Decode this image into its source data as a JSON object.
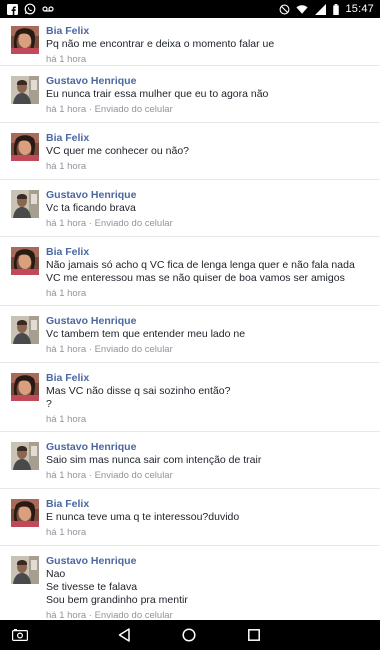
{
  "status_bar": {
    "left_icons": [
      "facebook-icon",
      "whatsapp-icon",
      "voicemail-icon"
    ],
    "right_icons": [
      "do-not-disturb-icon",
      "wifi-icon",
      "signal-icon",
      "battery-icon"
    ],
    "time": "15:47"
  },
  "messages": [
    {
      "author": "Bia Felix",
      "lines": [
        "Pq não me encontrar e deixa o momento falar ue"
      ],
      "meta": "há 1 hora",
      "avatar": "bia"
    },
    {
      "author": "Gustavo Henrique",
      "lines": [
        "Eu nunca trair essa mulher que eu to agora não"
      ],
      "meta": "há 1 hora · Enviado do celular",
      "avatar": "gustavo"
    },
    {
      "author": "Bia Felix",
      "lines": [
        "VC quer me conhecer ou não?"
      ],
      "meta": "há 1 hora",
      "avatar": "bia"
    },
    {
      "author": "Gustavo Henrique",
      "lines": [
        "Vc ta ficando brava"
      ],
      "meta": "há 1 hora · Enviado do celular",
      "avatar": "gustavo"
    },
    {
      "author": "Bia Felix",
      "lines": [
        "Não jamais só acho q VC fica de lenga lenga quer e não fala nada",
        "VC me enteressou mas se não quiser de boa vamos ser amigos"
      ],
      "meta": "há 1 hora",
      "avatar": "bia"
    },
    {
      "author": "Gustavo Henrique",
      "lines": [
        "Vc tambem tem que entender meu lado ne"
      ],
      "meta": "há 1 hora · Enviado do celular",
      "avatar": "gustavo"
    },
    {
      "author": "Bia Felix",
      "lines": [
        "Mas VC não disse q sai sozinho então?",
        "?"
      ],
      "meta": "há 1 hora",
      "avatar": "bia"
    },
    {
      "author": "Gustavo Henrique",
      "lines": [
        "Saio sim mas nunca sair com intenção de trair"
      ],
      "meta": "há 1 hora · Enviado do celular",
      "avatar": "gustavo"
    },
    {
      "author": "Bia Felix",
      "lines": [
        "E nunca teve uma q te interessou?duvido"
      ],
      "meta": "há 1 hora",
      "avatar": "bia"
    },
    {
      "author": "Gustavo Henrique",
      "lines": [
        "Nao",
        "Se tivesse te falava",
        "Sou bem grandinho pra mentir"
      ],
      "meta": "há 1 hora · Enviado do celular",
      "avatar": "gustavo"
    }
  ],
  "nav_bar": {
    "buttons": [
      "screenshot-icon",
      "back-icon",
      "home-icon",
      "recents-icon"
    ]
  },
  "colors": {
    "author": "#4b67a1",
    "text": "#1d2129",
    "meta": "#90949c",
    "divider": "#e6e8ec"
  }
}
